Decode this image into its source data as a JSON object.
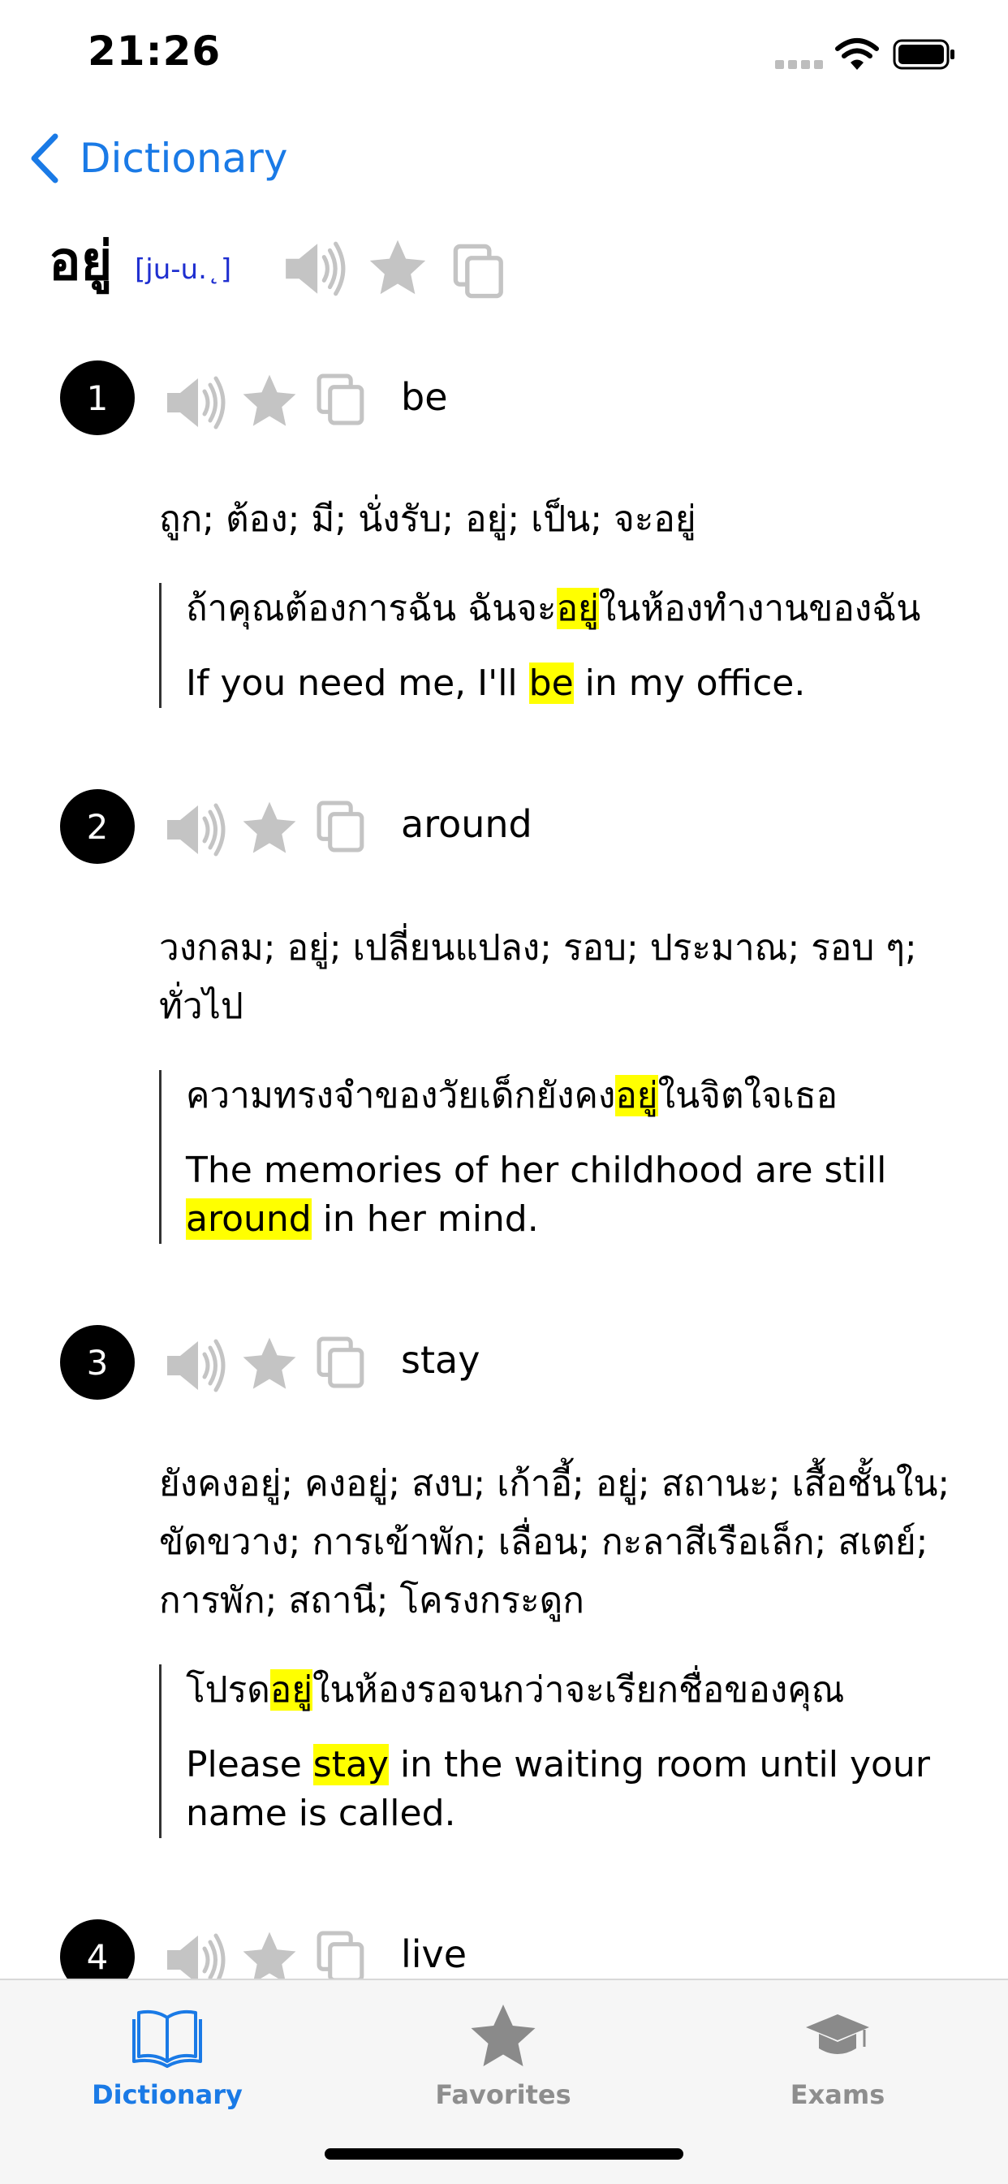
{
  "status": {
    "time": "21:26"
  },
  "nav": {
    "back_label": "Dictionary"
  },
  "entry": {
    "word": "อยู่",
    "pronunciation": "[ju-u.˛]",
    "senses": [
      {
        "number": "1",
        "word": "be",
        "synonyms": "ถูก; ต้อง; มี; นั่งรับ; อยู่; เป็น; จะอยู่",
        "example_th": {
          "before": "ถ้าคุณต้องการฉัน ฉันจะ",
          "highlight": "อยู่",
          "after": "ในห้องทำงานของฉัน"
        },
        "example_en": {
          "before": "If you need me, I'll ",
          "highlight": "be",
          "after": " in my office."
        }
      },
      {
        "number": "2",
        "word": "around",
        "synonyms": "วงกลม; อยู่; เปลี่ยนแปลง; รอบ; ประมาณ; รอบ ๆ; ทั่วไป",
        "example_th": {
          "before": "ความทรงจำของวัยเด็กยังคง",
          "highlight": "อยู่",
          "after": "ในจิตใจเธอ"
        },
        "example_en": {
          "before": "The memories of her childhood are still ",
          "highlight": "around",
          "after": " in her mind."
        }
      },
      {
        "number": "3",
        "word": "stay",
        "synonyms": "ยังคงอยู่; คงอยู่; สงบ; เก้าอี้; อยู่; สถานะ; เสื้อชั้นใน; ขัดขวาง; การเข้าพัก; เลื่อน; กะลาสีเรือเล็ก; สเตย์; การพัก; สถานี; โครงกระดูก",
        "example_th": {
          "before": "โปรด",
          "highlight": "อยู่",
          "after": "ในห้องรอจนกว่าจะเรียกชื่อของคุณ"
        },
        "example_en": {
          "before": "Please ",
          "highlight": "stay",
          "after": " in the waiting room until your name is called."
        }
      },
      {
        "number": "4",
        "word": "live"
      }
    ]
  },
  "tabbar": {
    "tabs": [
      {
        "label": "Dictionary",
        "icon": "book-icon",
        "active": true
      },
      {
        "label": "Favorites",
        "icon": "star-icon",
        "active": false
      },
      {
        "label": "Exams",
        "icon": "graduation-cap-icon",
        "active": false
      }
    ]
  },
  "colors": {
    "accent": "#1a7ae6",
    "highlight": "#ffff00",
    "icon_gray": "#bdbdbd",
    "pronunciation": "#1f2fd0"
  }
}
